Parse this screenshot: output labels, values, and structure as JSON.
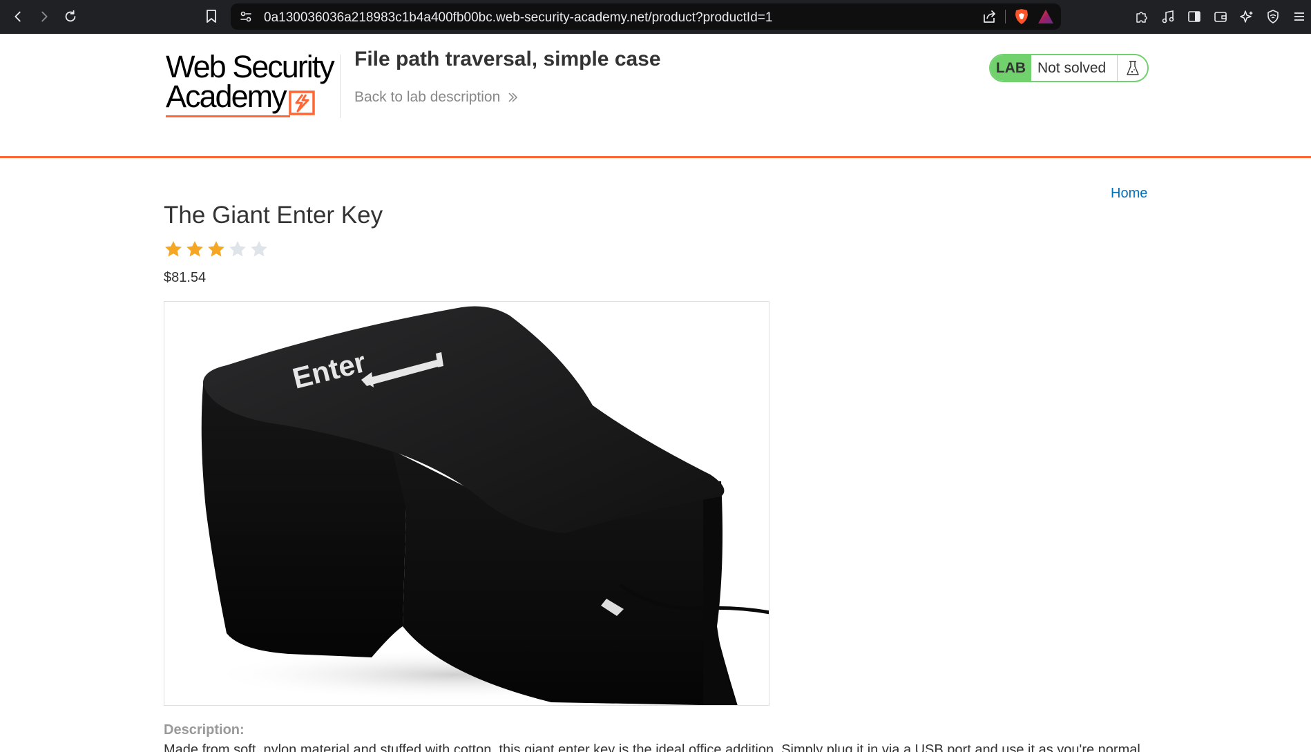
{
  "browser": {
    "url": "0a130036036a218983c1b4a400fb00bc.web-security-academy.net/product?productId=1",
    "icons": {
      "back": "back-arrow-icon",
      "forward": "forward-arrow-icon",
      "reload": "reload-icon",
      "bookmark": "bookmark-icon",
      "site_info": "tune-icon",
      "share": "share-icon",
      "shields": "brave-shields-icon",
      "rewards": "brave-rewards-icon",
      "extensions": "puzzle-icon",
      "media": "music-note-icon",
      "sidebar": "sidebar-icon",
      "wallet": "wallet-icon",
      "leo": "leo-sparkle-icon",
      "vpn": "vpn-shield-icon",
      "menu": "hamburger-menu-icon"
    }
  },
  "lab": {
    "logo_line1": "Web Security",
    "logo_line2": "Academy",
    "title": "File path traversal, simple case",
    "back_link": "Back to lab description",
    "status_badge": "LAB",
    "status_text": "Not solved",
    "colors": {
      "accent": "#ff6633",
      "status_green": "#70d16d",
      "link": "#0071bc"
    }
  },
  "nav": {
    "home": "Home"
  },
  "product": {
    "name": "The Giant Enter Key",
    "rating": 3,
    "rating_max": 5,
    "price": "$81.54",
    "image_key_label": "Enter",
    "description_label": "Description:",
    "description_text": "Made from soft, nylon material and stuffed with cotton, this giant enter key is the ideal office addition. Simply plug it in via a USB port and use it as you're normal"
  }
}
